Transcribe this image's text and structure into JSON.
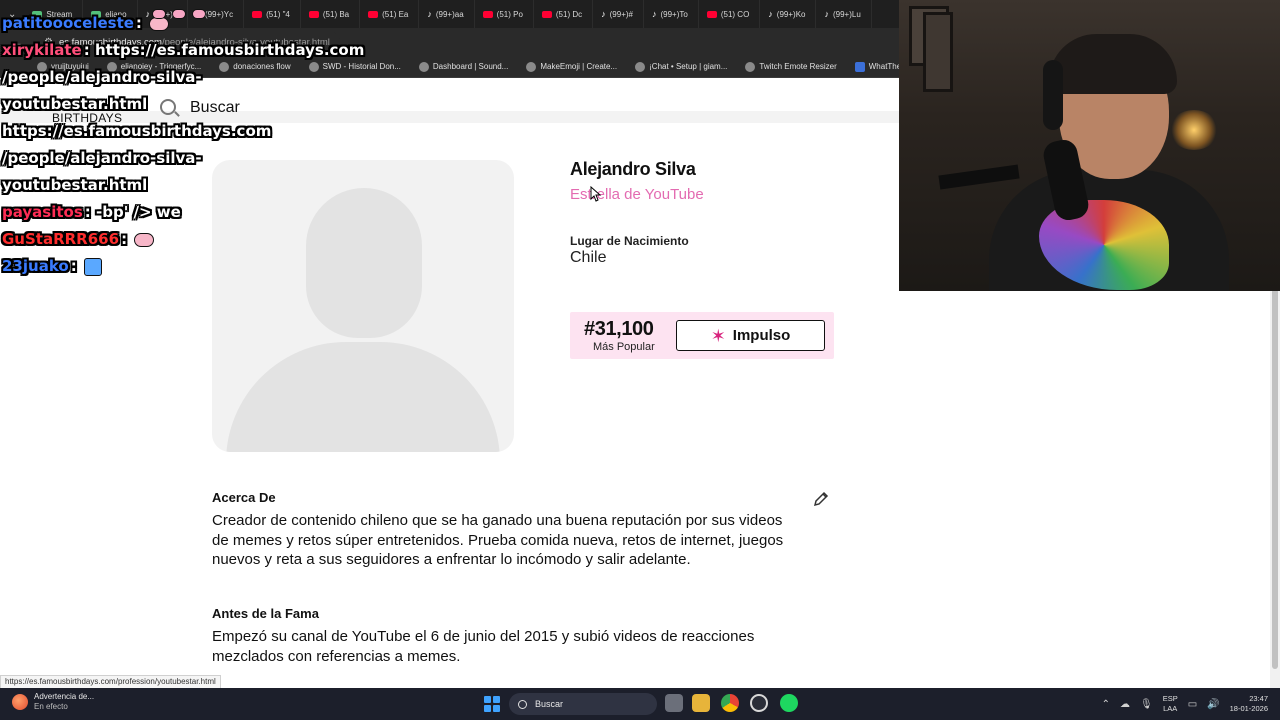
{
  "browser": {
    "tabs": [
      {
        "icon": "stream",
        "label": "Stream"
      },
      {
        "icon": "stream",
        "label": "eliano"
      },
      {
        "icon": "tiktok",
        "label": "(99+)#"
      },
      {
        "icon": "tiktok",
        "label": "(99+)Yc"
      },
      {
        "icon": "youtube",
        "label": "(51) \"4"
      },
      {
        "icon": "youtube",
        "label": "(51) Ba"
      },
      {
        "icon": "youtube",
        "label": "(51) Ea"
      },
      {
        "icon": "tiktok",
        "label": "(99+)aa"
      },
      {
        "icon": "youtube",
        "label": "(51) Po"
      },
      {
        "icon": "youtube",
        "label": "(51) Dc"
      },
      {
        "icon": "tiktok",
        "label": "(99+)#"
      },
      {
        "icon": "tiktok",
        "label": "(99+)To"
      },
      {
        "icon": "youtube",
        "label": "(51) CO"
      },
      {
        "icon": "tiktok",
        "label": "(99+)Ko"
      },
      {
        "icon": "tiktok",
        "label": "(99+)Lu"
      }
    ],
    "url_host": "es.famousbirthdays.com",
    "url_path": "/people/alejandro-silva-youtubestar.html",
    "bookmarks": [
      {
        "label": "yruijtuyuiui"
      },
      {
        "label": "elianoiey - Triggerfyc..."
      },
      {
        "label": "donaciones flow"
      },
      {
        "label": "SWD - Historial Don..."
      },
      {
        "label": "Dashboard | Sound..."
      },
      {
        "label": "MakeEmoji | Create..."
      },
      {
        "label": "¡Chat • Setup | giam..."
      },
      {
        "label": "Twitch Emote Resizer"
      },
      {
        "label": "WhatTheFont Font I..."
      }
    ]
  },
  "site": {
    "logo": "BIRTHDAYS",
    "search_placeholder": "Buscar"
  },
  "profile": {
    "name": "Alejandro Silva",
    "profession": "Estrella de YouTube",
    "birthplace_label": "Lugar de Nacimiento",
    "birthplace_value": "Chile",
    "rank": "#31,100",
    "rank_caption": "Más Popular",
    "boost_label": "Impulso"
  },
  "about": {
    "title": "Acerca De",
    "body": "Creador de contenido chileno que se ha ganado una buena reputación por sus videos de memes y retos súper entretenidos. Prueba comida nueva, retos de internet, juegos nuevos y reta a sus seguidores a enfrentar lo incómodo y salir adelante."
  },
  "before_fame": {
    "title": "Antes de la Fama",
    "body": "Empezó su canal de YouTube el 6 de junio del 2015 y subió videos de reacciones mezclados con referencias a memes."
  },
  "status_url": "https://es.famousbirthdays.com/profession/youtubestar.html",
  "taskbar": {
    "weather_title": "Advertencia de...",
    "weather_sub": "En efecto",
    "search_label": "Buscar",
    "lang_top": "ESP",
    "lang_bottom": "LAA",
    "time": "23:47",
    "date": "18-01-2026"
  },
  "chat": [
    {
      "user": "patitoooceleste",
      "user_color": "#3a7bff",
      "sep": ":",
      "text": "",
      "emote": "pig"
    },
    {
      "user": "xirykilate",
      "user_color": "#ff4f7b",
      "sep": ":",
      "text": "https://es.famousbirthdays.com",
      "emote": ""
    },
    {
      "user": "",
      "user_color": "#ffffff",
      "sep": "",
      "text": "/people/alejandro-silva-",
      "emote": ""
    },
    {
      "user": "",
      "user_color": "#ffffff",
      "sep": "",
      "text": "youtubestar.html",
      "emote": ""
    },
    {
      "user": "",
      "user_color": "#ffffff",
      "sep": "",
      "text": "https://es.famousbirthdays.com",
      "emote": ""
    },
    {
      "user": "",
      "user_color": "#ffffff",
      "sep": "",
      "text": "/people/alejandro-silva-",
      "emote": ""
    },
    {
      "user": "",
      "user_color": "#ffffff",
      "sep": "",
      "text": "youtubestar.html",
      "emote": ""
    },
    {
      "user": "payasitos",
      "user_color": "#ff2d55",
      "sep": ":",
      "text": "-bp' /> we",
      "emote": ""
    },
    {
      "user": "GuStaRRR666",
      "user_color": "#ff2d2d",
      "sep": ":",
      "text": "",
      "emote": "pig"
    },
    {
      "user": "23juako",
      "user_color": "#3a7bff",
      "sep": ":",
      "text": "",
      "emote": "blue"
    }
  ],
  "colors": {
    "profession_pink": "#e36bb1",
    "rank_bg": "#fde3f1",
    "boost_star": "#d8247e"
  }
}
